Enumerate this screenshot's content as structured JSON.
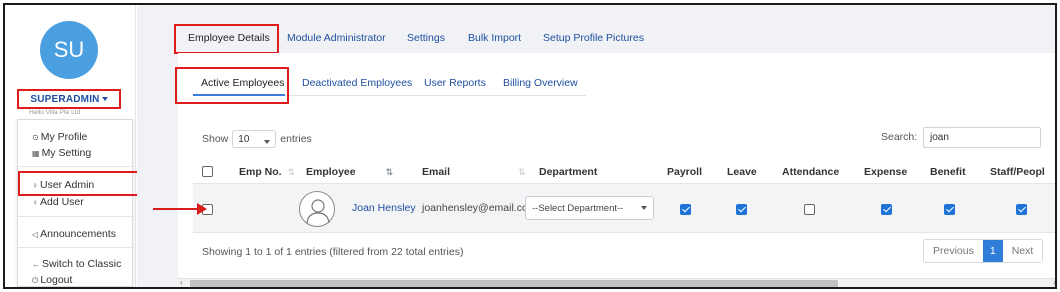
{
  "sidebar": {
    "avatar_initials": "SU",
    "user_name": "SUPERADMIN",
    "org_name": "Hello Villa Pte Ltd",
    "menu": [
      {
        "label": "My Profile",
        "icon": "profile-icon",
        "glyph": "⊙"
      },
      {
        "label": "My Setting",
        "icon": "settings-icon",
        "glyph": "▦"
      },
      {
        "label": "User Admin",
        "icon": "user-admin-icon",
        "glyph": "♀"
      },
      {
        "label": "Add User",
        "icon": "add-user-icon",
        "glyph": "♀"
      },
      {
        "label": "Announcements",
        "icon": "megaphone-icon",
        "glyph": "◁"
      },
      {
        "label": "Switch to Classic",
        "icon": "switch-icon",
        "glyph": "←"
      },
      {
        "label": "Logout",
        "icon": "power-icon",
        "glyph": "⏻"
      }
    ]
  },
  "top_tabs": [
    "Employee Details",
    "Module Administrator",
    "Settings",
    "Bulk Import",
    "Setup Profile Pictures"
  ],
  "sub_tabs": [
    "Active Employees",
    "Deactivated Employees",
    "User Reports",
    "Billing Overview"
  ],
  "table_controls": {
    "show_label": "Show",
    "page_size": "10",
    "entries_label": "entries",
    "search_label": "Search:",
    "search_value": "joan"
  },
  "columns": [
    "Emp No.",
    "Employee",
    "Email",
    "Department",
    "Payroll",
    "Leave",
    "Attendance",
    "Expense",
    "Benefit",
    "Staff/Peopl"
  ],
  "rows": [
    {
      "emp_no": "",
      "employee": "Joan Hensley",
      "email": "joanhensley@email.com",
      "department": "--Select Department--",
      "payroll": true,
      "leave": true,
      "attendance": false,
      "expense": true,
      "benefit": true,
      "staff": true
    }
  ],
  "table_info": "Showing 1 to 1 of 1 entries (filtered from 22 total entries)",
  "pagination": {
    "previous": "Previous",
    "current": "1",
    "next": "Next"
  },
  "colors": {
    "accent": "#1e73d6",
    "highlight_box": "#e01b1b",
    "avatar_bg": "#4a9fe0"
  }
}
